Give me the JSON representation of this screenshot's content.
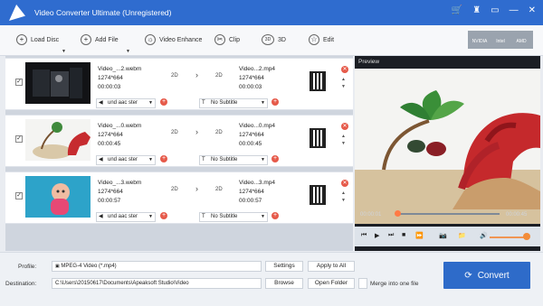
{
  "window": {
    "title": "Video Converter Ultimate (Unregistered)",
    "controls": [
      "🛒",
      "♜",
      "▭",
      "—",
      "✕"
    ]
  },
  "toolbar": {
    "load_disc": "Load Disc",
    "add_file": "Add File",
    "video_enhance": "Video Enhance",
    "clip": "Clip",
    "three_d": "3D",
    "three_d_icon": "3D",
    "edit": "Edit",
    "accelerators": [
      "NVIDIA",
      "Intel",
      "AMD"
    ]
  },
  "files": [
    {
      "source_name": "Video_...2.webm",
      "source_res": "1274*664",
      "source_duration": "00:00:03",
      "src_mode": "2D",
      "dst_mode": "2D",
      "target_name": "Video...2.mp4",
      "target_res": "1274*664",
      "target_duration": "00:00:03",
      "audio": "und aac ster",
      "subtitle": "No Subtitle"
    },
    {
      "source_name": "Video_...0.webm",
      "source_res": "1274*664",
      "source_duration": "00:00:45",
      "src_mode": "2D",
      "dst_mode": "2D",
      "target_name": "Video...0.mp4",
      "target_res": "1274*664",
      "target_duration": "00:00:45",
      "audio": "und aac ster",
      "subtitle": "No Subtitle"
    },
    {
      "source_name": "Video_...3.webm",
      "source_res": "1274*664",
      "source_duration": "00:00:57",
      "src_mode": "2D",
      "dst_mode": "2D",
      "target_name": "Video...3.mp4",
      "target_res": "1274*664",
      "target_duration": "00:00:57",
      "audio": "und aac ster",
      "subtitle": "No Subtitle"
    }
  ],
  "preview": {
    "label": "Preview",
    "current_time": "00:00:01",
    "total_time": "00:00:45",
    "progress": 0.02,
    "volume": 0.85
  },
  "bottom": {
    "profile_label": "Profile:",
    "profile_value": "MPEG-4 Video (*.mp4)",
    "settings": "Settings",
    "apply_all": "Apply to All",
    "destination_label": "Destination:",
    "destination_value": "C:\\Users\\20150617\\Documents\\Apeaksoft Studio\\Video",
    "browse": "Browse",
    "open_folder": "Open Folder",
    "merge": "Merge into one file",
    "convert": "Convert"
  }
}
